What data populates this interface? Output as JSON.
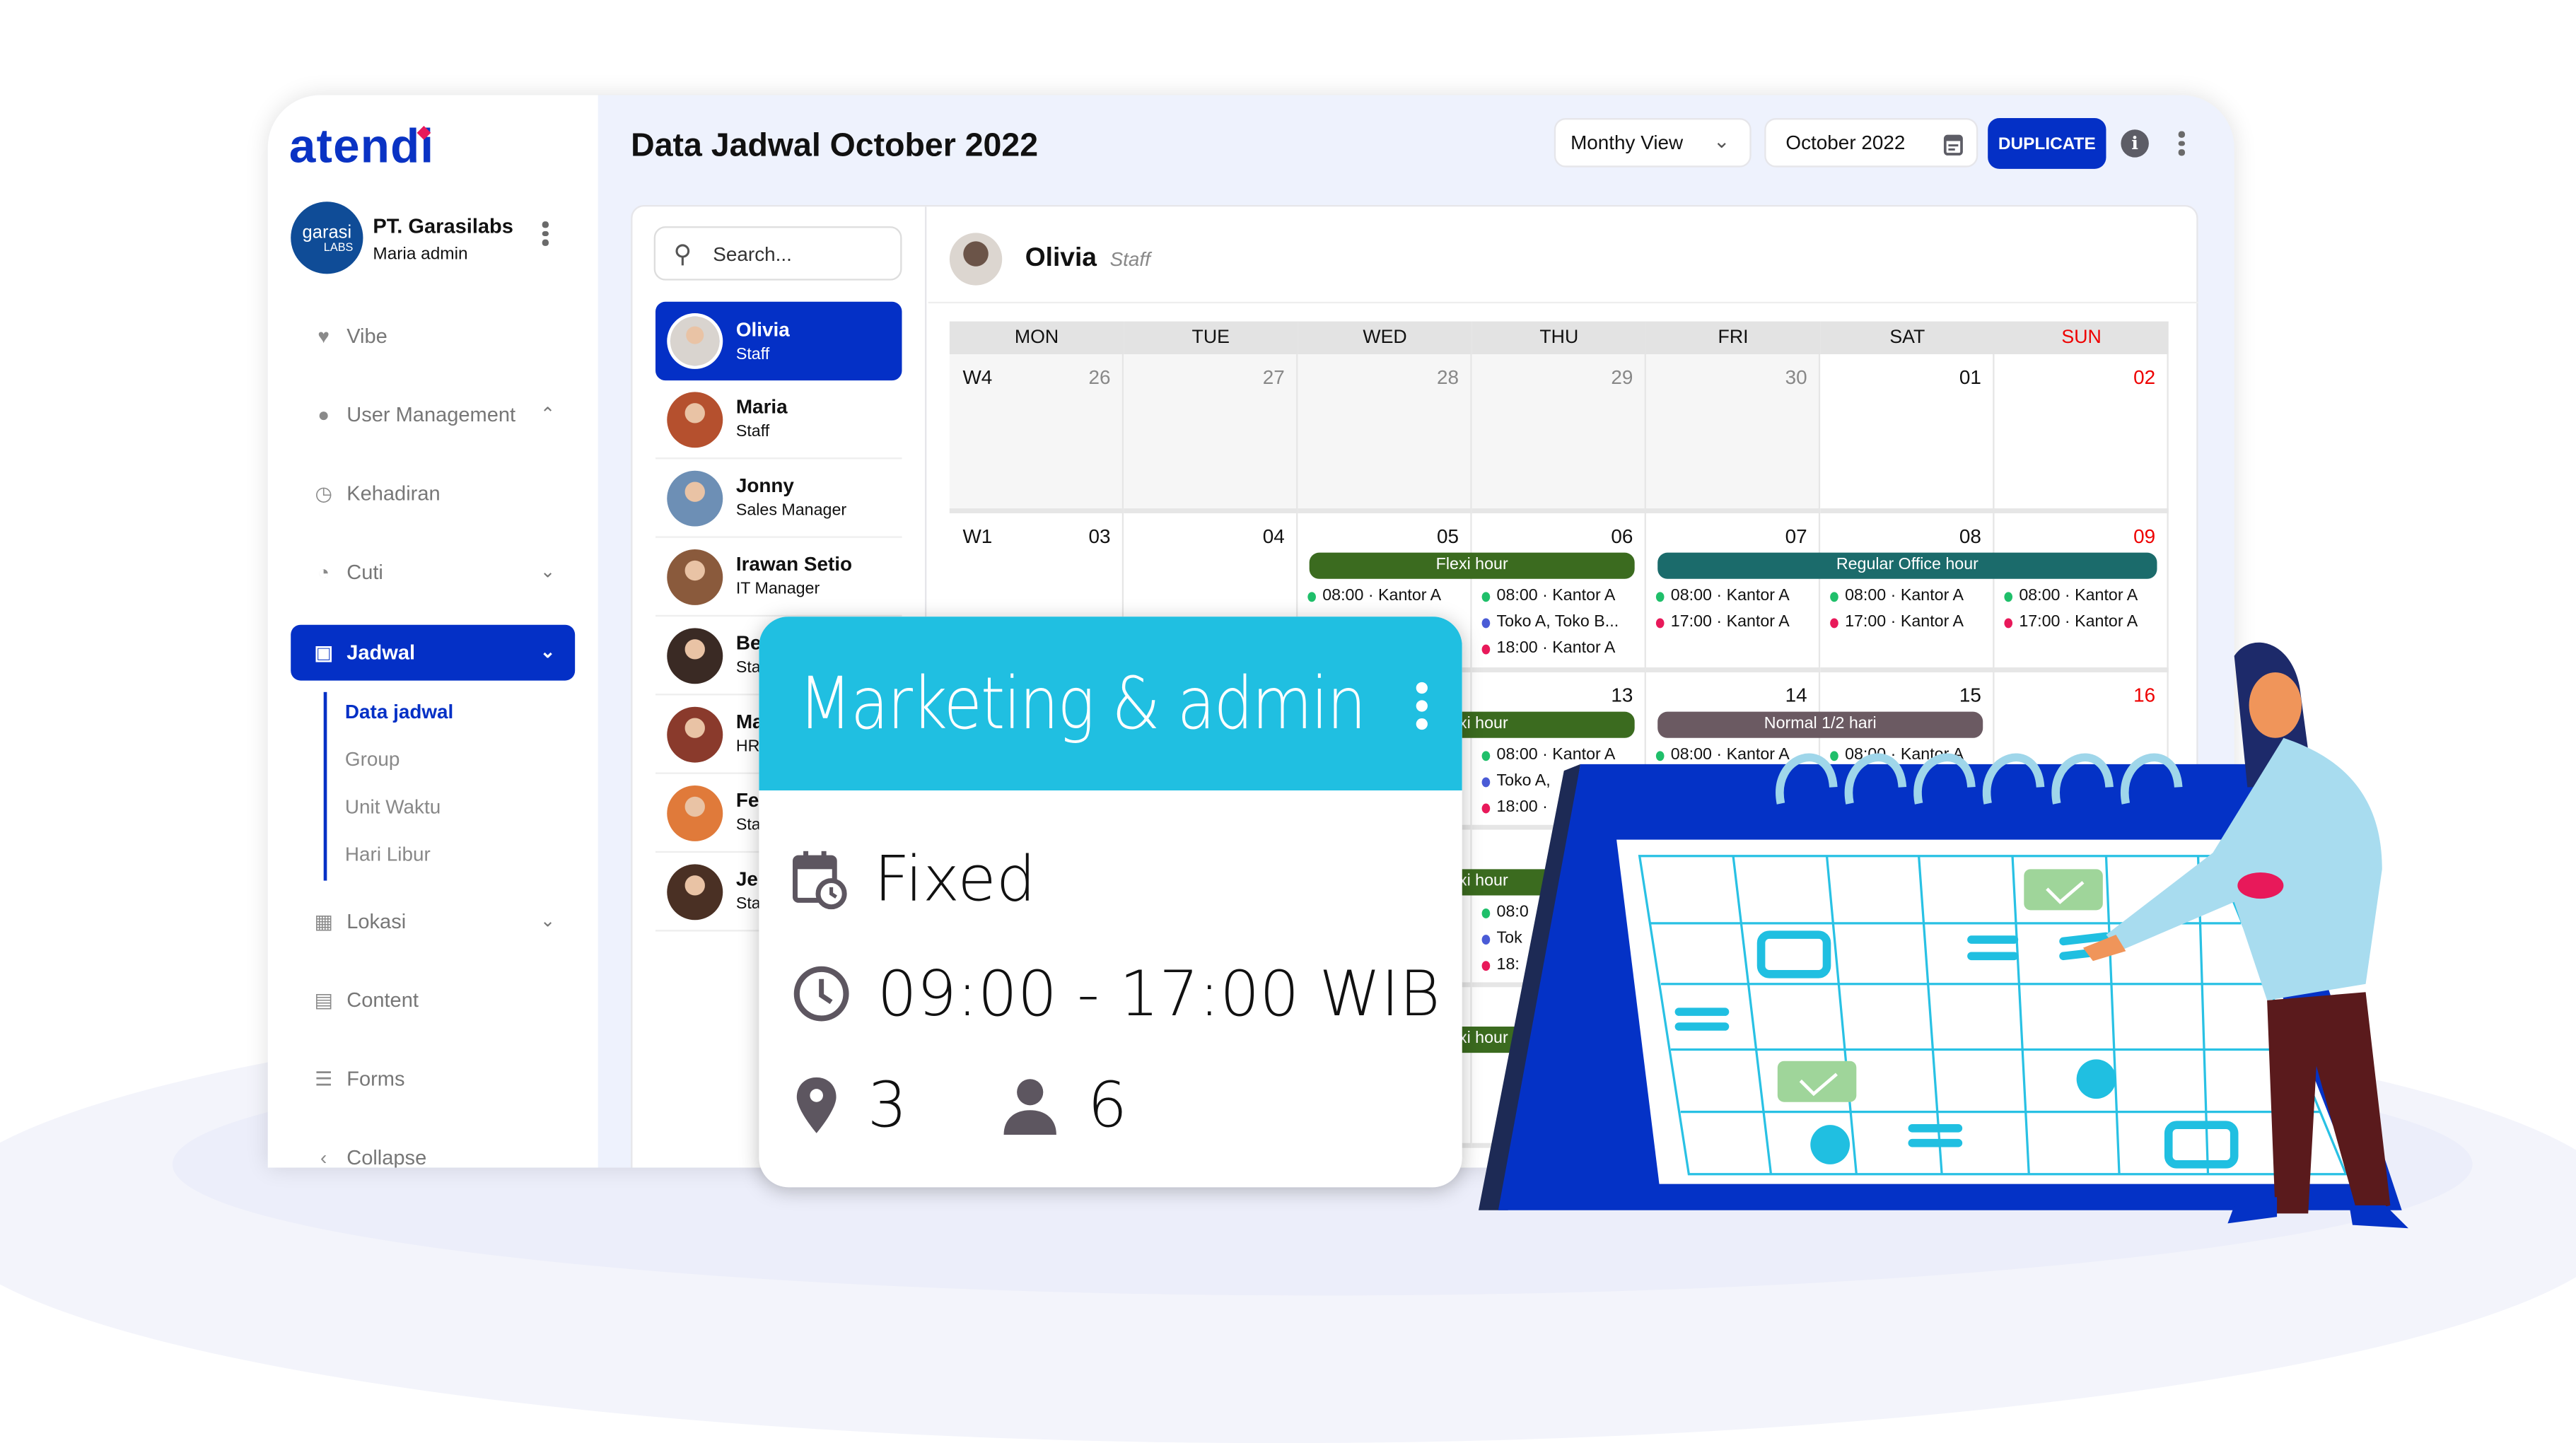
{
  "brand": {
    "logo": "atendi",
    "accent": "#0430c6"
  },
  "org": {
    "avatar_text": "garasi",
    "avatar_sub": "LABS",
    "name": "PT. Garasilabs",
    "user": "Maria admin"
  },
  "sidebar": {
    "items": [
      {
        "label": "Vibe",
        "icon": "heart-pulse-icon"
      },
      {
        "label": "User Management",
        "icon": "user-icon",
        "chevron": "up"
      },
      {
        "label": "Kehadiran",
        "icon": "clock-check-icon"
      },
      {
        "label": "Cuti",
        "icon": "leave-icon",
        "chevron": "down"
      },
      {
        "label": "Jadwal",
        "icon": "calendar-clock-icon",
        "chevron": "down",
        "active": true
      },
      {
        "label": "Lokasi",
        "icon": "building-icon",
        "chevron": "down"
      },
      {
        "label": "Content",
        "icon": "content-icon"
      },
      {
        "label": "Forms",
        "icon": "forms-icon"
      },
      {
        "label": "Collapse",
        "icon": "chevron-left-icon"
      }
    ],
    "sub_items": [
      "Data jadwal",
      "Group",
      "Unit Waktu",
      "Hari Libur"
    ]
  },
  "header": {
    "title": "Data Jadwal October 2022",
    "view_select": "Monthy View",
    "month_picker": "October 2022",
    "duplicate_label": "DUPLICATE",
    "info": "i"
  },
  "search": {
    "placeholder": "Search..."
  },
  "people": [
    {
      "name": "Olivia",
      "role": "Staff",
      "active": true,
      "color": "#d9d4cf"
    },
    {
      "name": "Maria",
      "role": "Staff",
      "color": "#b5502e"
    },
    {
      "name": "Jonny",
      "role": "Sales Manager",
      "color": "#6d8fb5"
    },
    {
      "name": "Irawan Setio",
      "role": "IT Manager",
      "color": "#8a5a3c"
    },
    {
      "name": "Be",
      "role": "Sta",
      "color": "#3a2a24"
    },
    {
      "name": "Ma",
      "role": "HR",
      "color": "#8a3a2c"
    },
    {
      "name": "Fe",
      "role": "Sta",
      "color": "#e07a3a"
    },
    {
      "name": "Je",
      "role": "Sta",
      "color": "#4a3024"
    }
  ],
  "calendar": {
    "person": {
      "name": "Olivia",
      "role": "Staff"
    },
    "days": [
      "MON",
      "TUE",
      "WED",
      "THU",
      "FRI",
      "SAT",
      "SUN"
    ],
    "weeks": [
      {
        "label": "W4",
        "dates": [
          "26",
          "27",
          "28",
          "29",
          "30",
          "01",
          "02"
        ],
        "prev": [
          true,
          true,
          true,
          true,
          true,
          false,
          false
        ]
      },
      {
        "label": "W1",
        "dates": [
          "03",
          "04",
          "05",
          "06",
          "07",
          "08",
          "09"
        ],
        "prev": [
          false,
          false,
          false,
          false,
          false,
          false,
          false
        ]
      },
      {
        "label": "",
        "dates": [
          "",
          "",
          "",
          "13",
          "14",
          "15",
          "16"
        ],
        "prev": [
          false,
          false,
          false,
          false,
          false,
          false,
          false
        ]
      },
      {
        "label": "",
        "dates": [
          "",
          "",
          "",
          "",
          "",
          "",
          ""
        ],
        "prev": [
          false,
          false,
          false,
          false,
          false,
          false,
          false
        ]
      },
      {
        "label": "",
        "dates": [
          "",
          "",
          "",
          "",
          "",
          "",
          ""
        ],
        "prev": [
          false,
          false,
          false,
          false,
          false,
          false,
          false
        ]
      }
    ],
    "bars": [
      {
        "week": 1,
        "from": 2,
        "to": 3,
        "label": "Flexi hour",
        "color": "#3b6b1f"
      },
      {
        "week": 1,
        "from": 4,
        "to": 6,
        "label": "Regular Office hour",
        "color": "#1b6b6b"
      },
      {
        "week": 2,
        "from": 2,
        "to": 3,
        "label": "Flexi hour",
        "color": "#3b6b1f"
      },
      {
        "week": 2,
        "from": 4,
        "to": 5,
        "label": "Normal 1/2 hari",
        "color": "#6b5a62"
      },
      {
        "week": 3,
        "from": 2,
        "to": 3,
        "label": "Flexi hour",
        "color": "#3b6b1f"
      },
      {
        "week": 4,
        "from": 2,
        "to": 3,
        "label": "Flexi hour",
        "color": "#3b6b1f"
      }
    ],
    "events": [
      {
        "week": 1,
        "day": 2,
        "items": [
          {
            "text": "08:00 · Kantor A",
            "dot": "#1fbf6a"
          }
        ]
      },
      {
        "week": 1,
        "day": 3,
        "items": [
          {
            "text": "08:00 · Kantor A",
            "dot": "#1fbf6a"
          },
          {
            "text": "Toko A, Toko B...",
            "dot": "#4a5bd6"
          },
          {
            "text": "18:00 · Kantor A",
            "dot": "#e8195a"
          }
        ]
      },
      {
        "week": 1,
        "day": 4,
        "items": [
          {
            "text": "08:00 · Kantor A",
            "dot": "#1fbf6a"
          },
          {
            "text": "17:00 · Kantor A",
            "dot": "#e8195a"
          }
        ]
      },
      {
        "week": 1,
        "day": 5,
        "items": [
          {
            "text": "08:00 · Kantor A",
            "dot": "#1fbf6a"
          },
          {
            "text": "17:00 · Kantor A",
            "dot": "#e8195a"
          }
        ]
      },
      {
        "week": 1,
        "day": 6,
        "items": [
          {
            "text": "08:00 · Kantor A",
            "dot": "#1fbf6a"
          },
          {
            "text": "17:00 · Kantor A",
            "dot": "#e8195a"
          }
        ]
      },
      {
        "week": 2,
        "day": 3,
        "items": [
          {
            "text": "08:00 · Kantor A",
            "dot": "#1fbf6a"
          },
          {
            "text": "Toko A,",
            "dot": "#4a5bd6"
          },
          {
            "text": "18:00 ·",
            "dot": "#e8195a"
          }
        ]
      },
      {
        "week": 2,
        "day": 4,
        "items": [
          {
            "text": "08:00 · Kantor A",
            "dot": "#1fbf6a"
          }
        ]
      },
      {
        "week": 2,
        "day": 5,
        "items": [
          {
            "text": "08:00 · Kantor A",
            "dot": "#1fbf6a"
          }
        ]
      },
      {
        "week": 3,
        "day": 3,
        "items": [
          {
            "text": "08:0",
            "dot": "#1fbf6a"
          },
          {
            "text": "Tok",
            "dot": "#4a5bd6"
          },
          {
            "text": "18:",
            "dot": "#e8195a"
          }
        ]
      }
    ]
  },
  "schedule_card": {
    "title": "Marketing & admin",
    "type": "Fixed",
    "time": "09:00 - 17:00 WIB",
    "locations": "3",
    "members": "6",
    "color": "#20bfe1"
  }
}
